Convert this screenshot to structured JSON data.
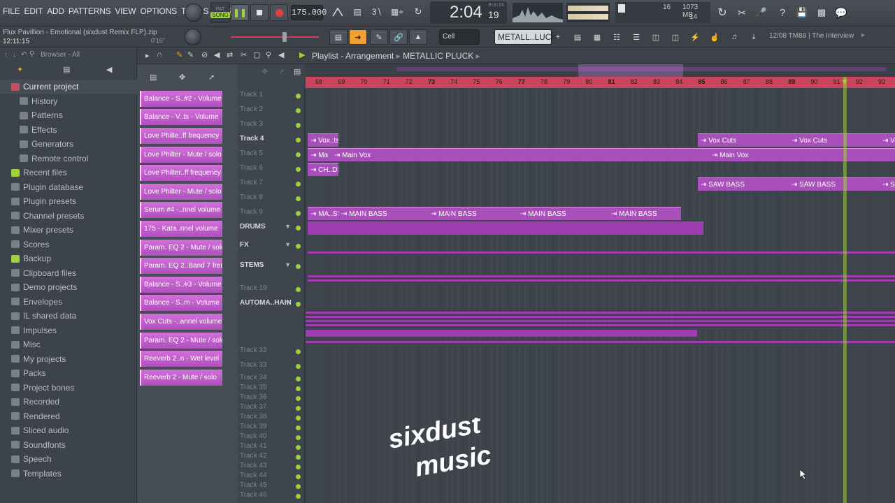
{
  "menu": [
    "FILE",
    "EDIT",
    "ADD",
    "PATTERNS",
    "VIEW",
    "OPTIONS",
    "TOOLS",
    "HELP"
  ],
  "song_file": "Flux Pavillion - Emotional (sixdust Remix FLP).zip",
  "song_time_small": "12:11:15",
  "pitch_display": "0'16\"",
  "song_mode": "SONG",
  "tempo": "175.000",
  "time_display": "2:04",
  "time_display_frac": "19",
  "time_label": "M:S:CS",
  "cpu_voices": "16",
  "memory": "1073 MB",
  "polyphony": "14",
  "snap": "Cell",
  "pattern_name": "METALL..LUCK",
  "news": "12/08  TM88 | The Interview",
  "browser_title": "Browser - All",
  "browser_items": [
    {
      "label": "Current project",
      "level": 0,
      "current": true
    },
    {
      "label": "History",
      "level": 1
    },
    {
      "label": "Patterns",
      "level": 1
    },
    {
      "label": "Effects",
      "level": 1
    },
    {
      "label": "Generators",
      "level": 1
    },
    {
      "label": "Remote control",
      "level": 1
    },
    {
      "label": "Recent files",
      "level": 0
    },
    {
      "label": "Plugin database",
      "level": 0
    },
    {
      "label": "Plugin presets",
      "level": 0
    },
    {
      "label": "Channel presets",
      "level": 0
    },
    {
      "label": "Mixer presets",
      "level": 0
    },
    {
      "label": "Scores",
      "level": 0
    },
    {
      "label": "Backup",
      "level": 0
    },
    {
      "label": "Clipboard files",
      "level": 0
    },
    {
      "label": "Demo projects",
      "level": 0
    },
    {
      "label": "Envelopes",
      "level": 0
    },
    {
      "label": "IL shared data",
      "level": 0
    },
    {
      "label": "Impulses",
      "level": 0
    },
    {
      "label": "Misc",
      "level": 0
    },
    {
      "label": "My projects",
      "level": 0
    },
    {
      "label": "Packs",
      "level": 0
    },
    {
      "label": "Project bones",
      "level": 0
    },
    {
      "label": "Recorded",
      "level": 0
    },
    {
      "label": "Rendered",
      "level": 0
    },
    {
      "label": "Sliced audio",
      "level": 0
    },
    {
      "label": "Soundfonts",
      "level": 0
    },
    {
      "label": "Speech",
      "level": 0
    },
    {
      "label": "Templates",
      "level": 0
    }
  ],
  "playlist_title": "Playlist - Arrangement",
  "playlist_pattern": "METALLIC PLUCK",
  "channels": [
    "Balance - S..#2 - Volume",
    "Balance - V..ts - Volume",
    "Love Philte..ff frequency",
    "Love Philter - Mute / solo",
    "Love Philter..ff frequency",
    "Love Philter - Mute / solo",
    "Serum #4 -..nnel volume",
    "175 - Kata..nnel volume",
    "Param. EQ 2 - Mute / solo",
    "Param. EQ 2..Band 7 freq",
    "Balance - S..#3 - Volume",
    "Balance - S..m - Volume",
    "Vox Cuts -..annel volume",
    "Param. EQ 2 - Mute / solo",
    "Reeverb 2..n - Wet level",
    "Reeverb 2 - Mute / solo"
  ],
  "ruler_bars": [
    "68",
    "69",
    "70",
    "71",
    "72",
    "73",
    "74",
    "75",
    "76",
    "77",
    "78",
    "79",
    "80",
    "81",
    "82",
    "83",
    "84",
    "85",
    "86",
    "87",
    "88",
    "89",
    "90",
    "91",
    "92",
    "93"
  ],
  "tracks": [
    {
      "label": "Track 1",
      "bold": false
    },
    {
      "label": "Track 2",
      "bold": false
    },
    {
      "label": "Track 3",
      "bold": false
    },
    {
      "label": "Track 4",
      "bold": true
    },
    {
      "label": "Track 5",
      "bold": false
    },
    {
      "label": "Track 6",
      "bold": false
    },
    {
      "label": "Track 7",
      "bold": false
    },
    {
      "label": "Track 8",
      "bold": false
    },
    {
      "label": "Track 9",
      "bold": false
    },
    {
      "label": "DRUMS",
      "bold": true
    },
    {
      "label": "FX",
      "bold": true
    },
    {
      "label": "STEMS",
      "bold": true
    },
    {
      "label": "Track 19",
      "bold": false
    },
    {
      "label": "AUTOMA..HAIN",
      "bold": true
    },
    {
      "label": "Track 32",
      "bold": false
    },
    {
      "label": "Track 33",
      "bold": false
    },
    {
      "label": "Track 34",
      "bold": false
    },
    {
      "label": "Track 35",
      "bold": false
    },
    {
      "label": "Track 36",
      "bold": false
    },
    {
      "label": "Track 37",
      "bold": false
    },
    {
      "label": "Track 38",
      "bold": false
    },
    {
      "label": "Track 39",
      "bold": false
    },
    {
      "label": "Track 40",
      "bold": false
    },
    {
      "label": "Track 41",
      "bold": false
    },
    {
      "label": "Track 42",
      "bold": false
    },
    {
      "label": "Track 43",
      "bold": false
    },
    {
      "label": "Track 44",
      "bold": false
    },
    {
      "label": "Track 45",
      "bold": false
    },
    {
      "label": "Track 46",
      "bold": false
    }
  ],
  "clips": [
    {
      "label": "Vox..ts"
    },
    {
      "label": "Vox Cuts"
    },
    {
      "label": "Vox Cuts"
    },
    {
      "label": "Vo"
    },
    {
      "label": "Ma"
    },
    {
      "label": "Main Vox"
    },
    {
      "label": "Main Vox"
    },
    {
      "label": "CH..DS"
    },
    {
      "label": "SAW BASS"
    },
    {
      "label": "SAW BASS"
    },
    {
      "label": "SAW"
    },
    {
      "label": "MA..SS"
    },
    {
      "label": "MAIN BASS"
    },
    {
      "label": "MAIN BASS"
    },
    {
      "label": "MAIN BASS"
    },
    {
      "label": "MAIN BASS"
    }
  ],
  "watermark": {
    "line1": "sixdust",
    "line2": "music"
  },
  "colors": {
    "clip": "#b250c4",
    "ruler": "#c9455e",
    "playhead": "#a0d23c",
    "accent": "#f0a030"
  }
}
